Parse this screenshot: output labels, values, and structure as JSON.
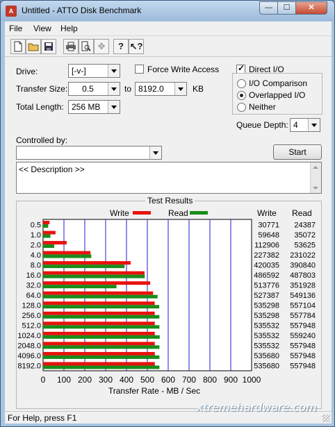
{
  "window": {
    "title": "Untitled - ATTO Disk Benchmark"
  },
  "menu": [
    "File",
    "View",
    "Help"
  ],
  "toolbar_icons": [
    "new-file-icon",
    "open-folder-icon",
    "save-icon",
    "print-icon",
    "print-preview-icon",
    "move-icon",
    "help-icon",
    "context-help-icon"
  ],
  "settings": {
    "drive_label": "Drive:",
    "drive_value": "[-v-]",
    "force_write_label": "Force Write Access",
    "force_write_checked": false,
    "direct_io_label": "Direct I/O",
    "direct_io_checked": true,
    "transfer_size_label": "Transfer Size:",
    "transfer_min": "0.5",
    "to_label": "to",
    "transfer_max": "8192.0",
    "kb_label": "KB",
    "total_length_label": "Total Length:",
    "total_length_value": "256 MB",
    "io_comparison_label": "I/O Comparison",
    "overlapped_io_label": "Overlapped I/O",
    "neither_label": "Neither",
    "selected_io_mode": "Overlapped I/O",
    "queue_depth_label": "Queue Depth:",
    "queue_depth_value": "4",
    "controlled_by_label": "Controlled by:",
    "controlled_by_value": "",
    "start_label": "Start",
    "description_text": "<< Description >>"
  },
  "results": {
    "title": "Test Results",
    "write_legend": "Write",
    "read_legend": "Read",
    "write_col": "Write",
    "read_col": "Read",
    "xlabel": "Transfer Rate - MB / Sec"
  },
  "chart_data": {
    "type": "bar",
    "orientation": "horizontal",
    "title": "Test Results",
    "xlabel": "Transfer Rate - MB / Sec",
    "xlim": [
      0,
      1000
    ],
    "xticks": [
      "0",
      "100",
      "200",
      "300",
      "400",
      "500",
      "600",
      "700",
      "800",
      "900",
      "1000"
    ],
    "categories": [
      "0.5",
      "1.0",
      "2.0",
      "4.0",
      "8.0",
      "16.0",
      "32.0",
      "64.0",
      "128.0",
      "256.0",
      "512.0",
      "1024.0",
      "2048.0",
      "4096.0",
      "8192.0"
    ],
    "series": [
      {
        "name": "Write",
        "color": "#e8120c",
        "values": [
          30.8,
          59.6,
          112.9,
          227.4,
          420.0,
          486.6,
          513.8,
          527.4,
          535.3,
          535.3,
          535.5,
          535.5,
          535.5,
          535.7,
          535.7
        ],
        "labels": [
          "30771",
          "59648",
          "112906",
          "227382",
          "420035",
          "486592",
          "513776",
          "527387",
          "535298",
          "535298",
          "535532",
          "535532",
          "535532",
          "535680",
          "535680"
        ]
      },
      {
        "name": "Read",
        "color": "#1a8c1a",
        "values": [
          24.4,
          35.1,
          53.6,
          231.0,
          390.8,
          487.8,
          351.9,
          549.1,
          557.1,
          557.8,
          557.9,
          559.2,
          557.9,
          557.9,
          557.9
        ],
        "labels": [
          "24387",
          "35072",
          "53625",
          "231022",
          "390840",
          "487803",
          "351928",
          "549136",
          "557104",
          "557784",
          "557948",
          "559240",
          "557948",
          "557948",
          "557948"
        ]
      }
    ],
    "grid": true,
    "gridline_color": "#1b1bd6",
    "legend": "top"
  },
  "status": {
    "text": "For Help, press F1"
  },
  "watermark": "xtremehardware.com"
}
